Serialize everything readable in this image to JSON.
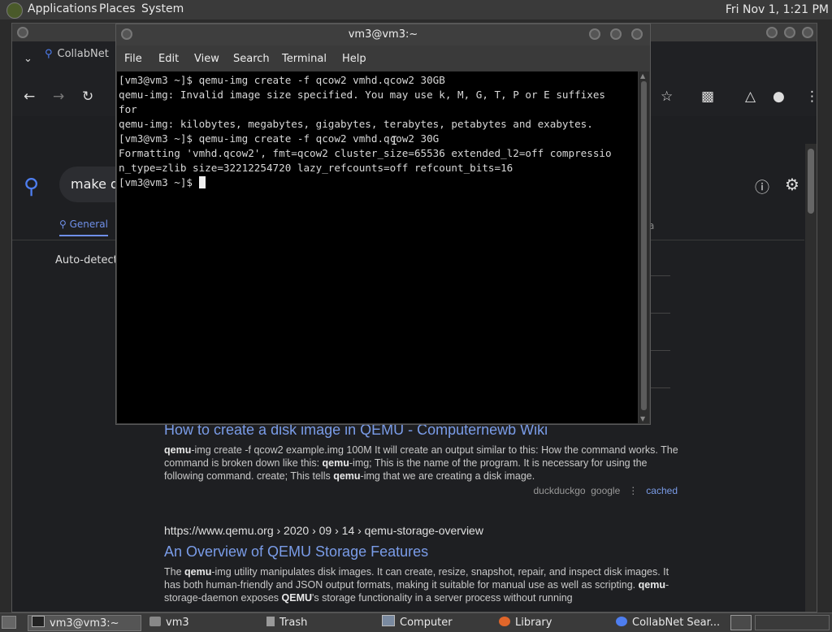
{
  "top_panel": {
    "menus": [
      "Applications",
      "Places",
      "System"
    ],
    "clock": "Fri Nov 1,  1:21 PM"
  },
  "browser": {
    "tab_label": "CollabNet",
    "search_query": "make qe",
    "tabs": {
      "general": "General",
      "media": "dia"
    },
    "autodetect": "Auto-detect (",
    "results": [
      {
        "title": "How to create a disk image in QEMU - Computernewb Wiki",
        "snippet_parts": [
          "qemu",
          "-img create -f qcow2 example.img 100M It will create an output similar to this: How the command works. The command is broken down like this: ",
          "qemu",
          "-img; This is the name of the program. It is necessary for using the following command. create; This tells ",
          "qemu",
          "-img that we are creating a disk image."
        ],
        "meta": [
          "duckduckgo",
          "google",
          "⋮",
          "cached"
        ]
      },
      {
        "url": "https://www.qemu.org  › 2020 › 09 › 14 › qemu-storage-overview",
        "title": "An Overview of QEMU Storage Features",
        "snippet_parts": [
          "The ",
          "qemu",
          "-img utility manipulates disk images. It can create, resize, snapshot, repair, and inspect disk images. It has both human-friendly and JSON output formats, making it suitable for manual use as well as scripting. ",
          "qemu",
          "-storage-daemon exposes ",
          "QEMU",
          "'s storage functionality in a server process without running"
        ]
      }
    ]
  },
  "terminal": {
    "title": "vm3@vm3:~",
    "menus": [
      "File",
      "Edit",
      "View",
      "Search",
      "Terminal",
      "Help"
    ],
    "lines": [
      "[vm3@vm3 ~]$ qemu-img create -f qcow2 vmhd.qcow2 30GB",
      "qemu-img: Invalid image size specified. You may use k, M, G, T, P or E suffixes",
      "for",
      "qemu-img: kilobytes, megabytes, gigabytes, terabytes, petabytes and exabytes.",
      "[vm3@vm3 ~]$ qemu-img create -f qcow2 vmhd.qcow2 30G",
      "Formatting 'vmhd.qcow2', fmt=qcow2 cluster_size=65536 extended_l2=off compressio",
      "n_type=zlib size=32212254720 lazy_refcounts=off refcount_bits=16"
    ],
    "prompt": "[vm3@vm3 ~]$ "
  },
  "taskbar": {
    "items": [
      "vm3@vm3:~",
      "vm3",
      "Trash",
      "Computer",
      "Library",
      "CollabNet Sear..."
    ]
  },
  "colors": {
    "accent": "#4e7ef0",
    "link": "#7a9ce8",
    "terminal_bg": "#000000"
  }
}
